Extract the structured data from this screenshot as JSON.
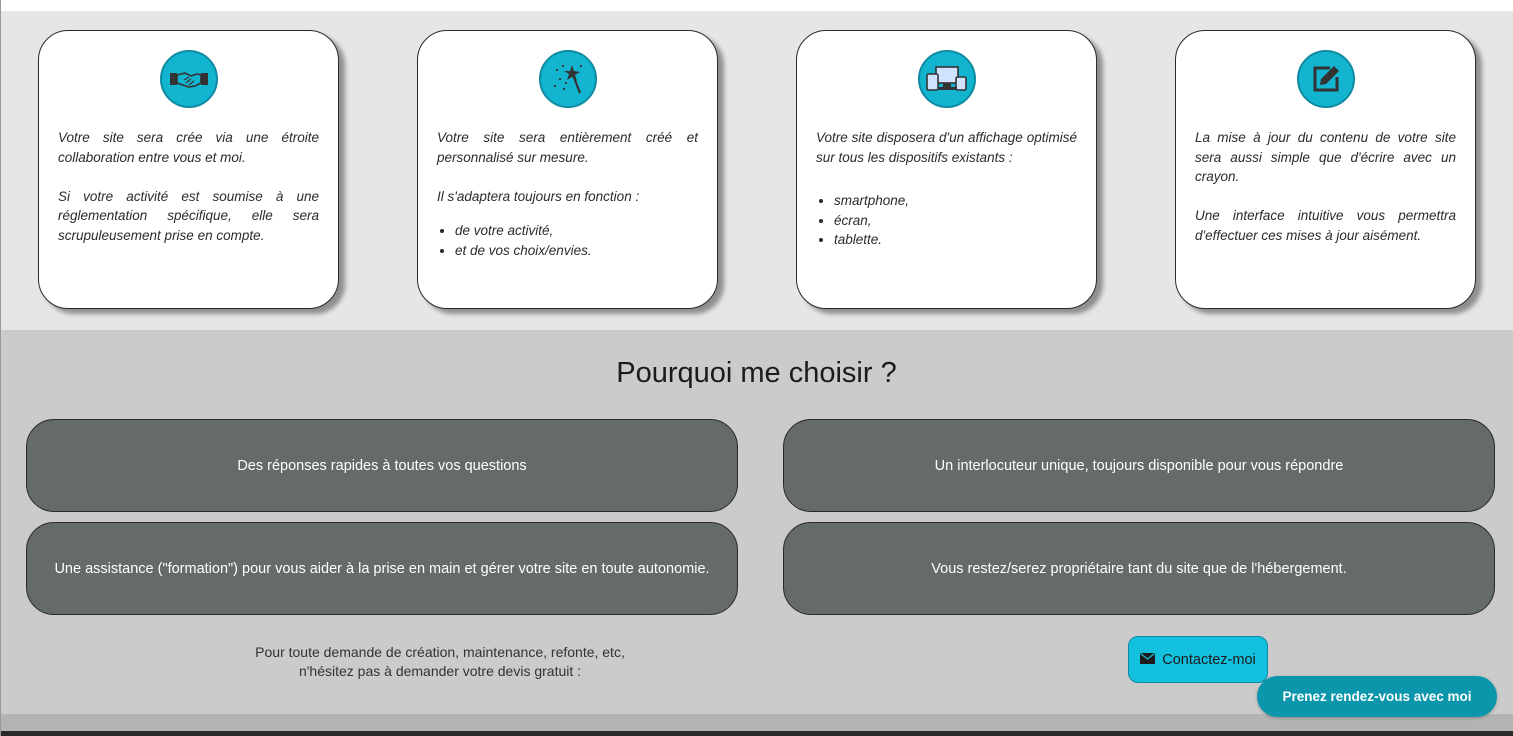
{
  "cards": [
    {
      "icon": "handshake-icon",
      "paragraphs": [
        "Votre site sera crée via une étroite collaboration entre vous et moi.",
        "Si votre activité est soumise à une réglementation spécifique, elle sera scrupuleusement prise en compte."
      ],
      "bullets": []
    },
    {
      "icon": "magic-wand-icon",
      "paragraphs": [
        "Votre site sera entièrement créé et personnalisé sur mesure.",
        "Il s'adaptera toujours en fonction :"
      ],
      "bullets": [
        "de votre activité,",
        "et de vos choix/envies."
      ]
    },
    {
      "icon": "devices-icon",
      "paragraphs": [
        "Votre site disposera d'un affichage optimisé sur tous les dispositifs existants :"
      ],
      "bullets": [
        "smartphone,",
        "écran,",
        "tablette."
      ]
    },
    {
      "icon": "edit-icon",
      "paragraphs": [
        "La mise à jour du contenu de votre site sera aussi simple que d'écrire avec un crayon.",
        "Une interface intuitive vous permettra d'effectuer ces mises à jour aisément."
      ],
      "bullets": []
    }
  ],
  "why": {
    "title": "Pourquoi me choisir ?",
    "reasons": [
      "Des réponses rapides à toutes vos questions",
      "Un interlocuteur unique, toujours disponible pour vous répondre",
      "Une assistance (\"formation\") pour vous aider à la prise en main et gérer votre site en toute autonomie.",
      "Vous restez/serez propriétaire tant du site que de l'hébergement."
    ]
  },
  "cta": {
    "line1": "Pour toute demande de création, maintenance, refonte, etc,",
    "line2": "n'hésitez pas à demander votre devis gratuit :",
    "contact_label": "Contactez-moi",
    "contact_icon": "envelope-icon"
  },
  "floating": {
    "rdv_label": "Prenez rendez-vous avec moi"
  },
  "colors": {
    "accent": "#13b4cf",
    "pill": "#656a6b",
    "rdv": "#0b96ab"
  }
}
